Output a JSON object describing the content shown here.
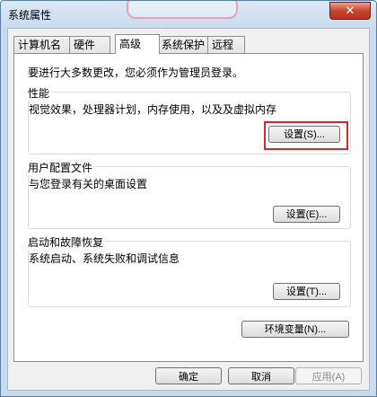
{
  "window": {
    "title": "系统属性",
    "close_glyph": "✕"
  },
  "tabs": [
    {
      "label": "计算机名"
    },
    {
      "label": "硬件"
    },
    {
      "label": "高级",
      "active": true
    },
    {
      "label": "系统保护"
    },
    {
      "label": "远程"
    }
  ],
  "advanced": {
    "notice": "要进行大多数更改，您必须作为管理员登录。",
    "performance": {
      "title": "性能",
      "description": "视觉效果，处理器计划，内存使用，以及及虚拟内存",
      "button": "设置(S)..."
    },
    "user_profiles": {
      "title": "用户配置文件",
      "description": "与您登录有关的桌面设置",
      "button": "设置(E)..."
    },
    "startup_recovery": {
      "title": "启动和故障恢复",
      "description": "系统启动、系统失败和调试信息",
      "button": "设置(T)..."
    },
    "env_button": "环境变量(N)..."
  },
  "footer": {
    "ok": "确定",
    "cancel": "取消",
    "apply": "应用(A)"
  },
  "colors": {
    "highlight": "#d4262d",
    "close_button": "#c7452c"
  }
}
